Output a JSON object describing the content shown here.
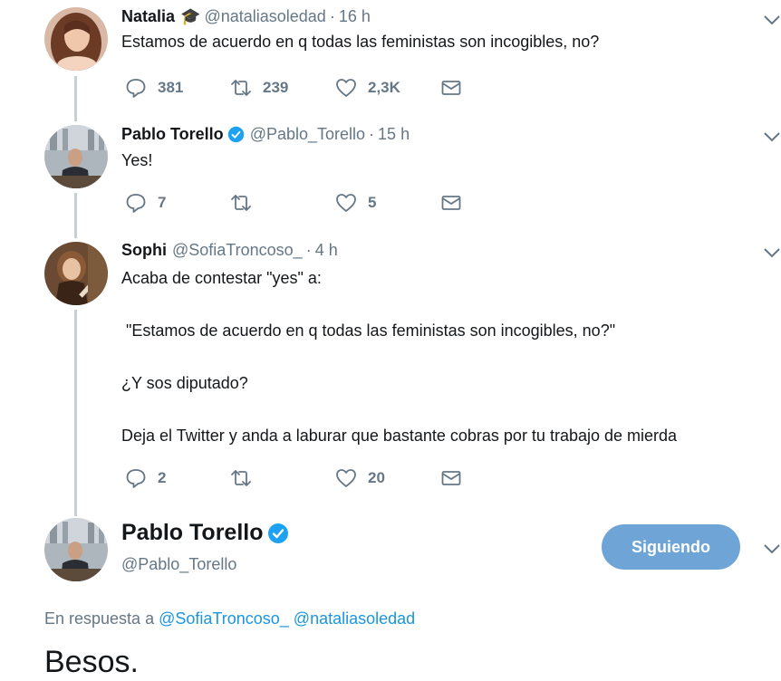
{
  "tweets": [
    {
      "name": "Natalia",
      "handle": "@nataliasoledad",
      "time": "16 h",
      "text": "Estamos de acuerdo en q todas las feministas son incogibles, no?",
      "replies": "381",
      "retweets": "239",
      "likes": "2,3K"
    },
    {
      "name": "Pablo Torello",
      "handle": "@Pablo_Torello",
      "time": "15 h",
      "text": "Yes!",
      "replies": "7",
      "retweets": "",
      "likes": "5"
    },
    {
      "name": "Sophi",
      "handle": "@SofiaTroncoso_",
      "time": "4 h",
      "lines": [
        "Acaba de contestar \"yes\" a:",
        " \"Estamos de acuerdo en q todas las feministas son incogibles, no?\"",
        "¿Y sos diputado?",
        "Deja el Twitter y anda a laburar que bastante cobras por tu trabajo de mierda"
      ],
      "replies": "2",
      "retweets": "",
      "likes": "20"
    }
  ],
  "main_tweet": {
    "name": "Pablo Torello",
    "handle": "@Pablo_Torello",
    "follow_label": "Siguiendo",
    "reply_prefix": "En respuesta a",
    "reply_to_1": "@SofiaTroncoso_",
    "reply_to_2": "@nataliasoledad",
    "text": "Besos."
  },
  "colors": {
    "accent": "#1b95e0",
    "follow_button": "#6fa5d6",
    "secondary_text": "#657786",
    "thread_line": "#c4cfd6"
  },
  "icons": {
    "reply": "reply-icon",
    "retweet": "retweet-icon",
    "like": "heart-icon",
    "dm": "envelope-icon",
    "caret": "chevron-down-icon",
    "verified": "verified-badge-icon",
    "natalia_emoji": "graduation-cap-icon"
  }
}
